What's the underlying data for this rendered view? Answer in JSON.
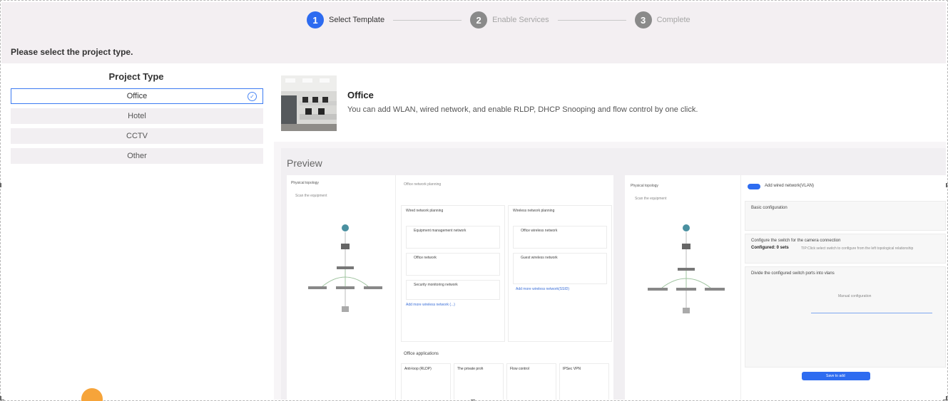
{
  "stepper": {
    "steps": [
      {
        "num": "1",
        "label": "Select Template",
        "state": "active"
      },
      {
        "num": "2",
        "label": "Enable Services",
        "state": "todo"
      },
      {
        "num": "3",
        "label": "Complete",
        "state": "todo"
      }
    ]
  },
  "page": {
    "title": "Please select the project type."
  },
  "project_type": {
    "heading": "Project Type",
    "items": [
      "Office",
      "Hotel",
      "CCTV",
      "Other"
    ],
    "selected": "Office"
  },
  "template_card": {
    "title": "Office",
    "description": "You can add WLAN, wired network, and enable RLDP, DHCP Snooping and flow control by one click."
  },
  "preview": {
    "title": "Preview",
    "left_shot": {
      "side_title": "Physical topology",
      "side_item": "Scan the equipment",
      "sections": [
        "Office network planning",
        "Office applications"
      ],
      "wired_header": "Wired network planning",
      "wireless_header": "Wireless network planning",
      "wired_items": [
        "Equipment management network",
        "Office network",
        "Security monitoring network"
      ],
      "wireless_items": [
        "Office wireless network",
        "Guest wireless network"
      ],
      "wired_add": "Add more wireless network (...)",
      "wireless_add": "Add more wireless network(SSID)",
      "apps": [
        "Anti-loop (RLDP)",
        "The private proh",
        "Flow control",
        "IPSec VPN"
      ]
    },
    "right_shot": {
      "side_title": "Physical topology",
      "side_item": "Scan the equipment",
      "toggle_label": "Add wired network(VLAN)",
      "sections": [
        "Basic configuration",
        "Configure the switch for the camera connection",
        "Divide the configured switch ports into vlans"
      ],
      "configured_label": "Configured: 0 sets",
      "configured_tip": "TIP:Click select switch to configure from the left topological relationship",
      "manual": "Manual configuration",
      "save_button": "Save to add"
    }
  }
}
